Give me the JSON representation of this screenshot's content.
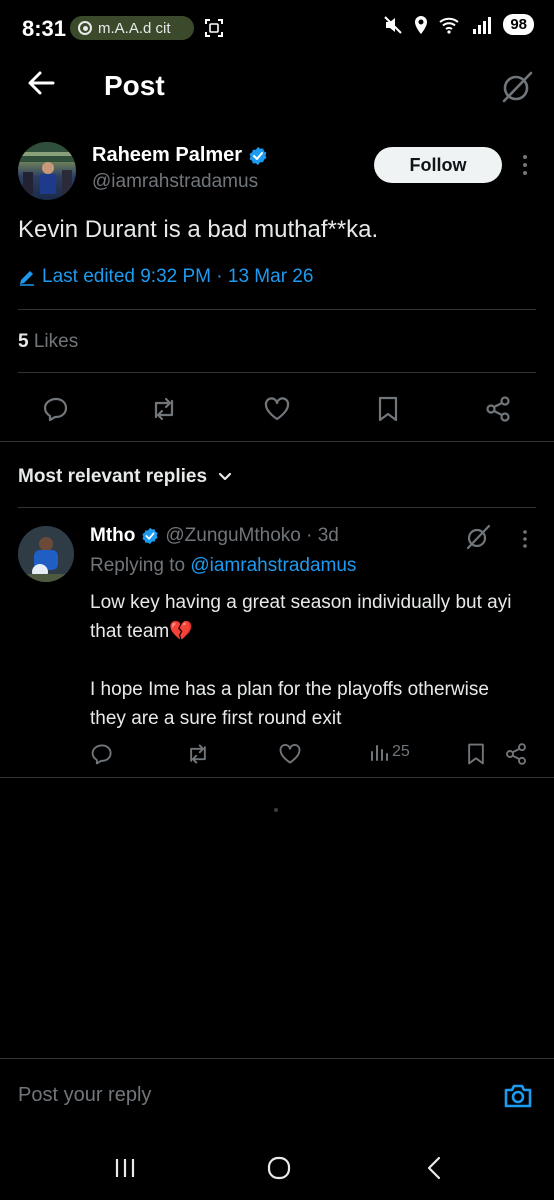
{
  "status_bar": {
    "time": "8:31",
    "media_text": "m.A.A.d cit",
    "battery": "98"
  },
  "header": {
    "title": "Post"
  },
  "post": {
    "author_name": "Raheem Palmer",
    "author_handle": "@iamrahstradamus",
    "follow_label": "Follow",
    "text": "Kevin Durant is a bad muthaf**ka.",
    "edited_label": "Last edited 9:32 PM · 13 Mar 26",
    "likes_count": "5",
    "likes_label": "Likes"
  },
  "replies_section": {
    "sort_label": "Most relevant replies"
  },
  "reply": {
    "name": "Mtho",
    "handle_time": "@ZunguMthoko · 3d",
    "replying_prefix": "Replying to",
    "replying_to": "@iamrahstradamus",
    "paragraph1": "Low key having a great season individually but ayi that team💔",
    "paragraph2": "I hope Ime has a plan for the playoffs otherwise they are a sure first round exit",
    "views": "25"
  },
  "composer": {
    "placeholder": "Post your reply"
  },
  "colors": {
    "accent": "#1d9bf0",
    "background": "#000000",
    "muted": "#71767b"
  },
  "icons": [
    "back-arrow-icon",
    "grok-icon",
    "verified-badge-icon",
    "more-icon",
    "edit-icon",
    "reply-icon",
    "repost-icon",
    "like-icon",
    "bookmark-icon",
    "share-icon",
    "chevron-down-icon",
    "views-icon",
    "camera-icon"
  ]
}
